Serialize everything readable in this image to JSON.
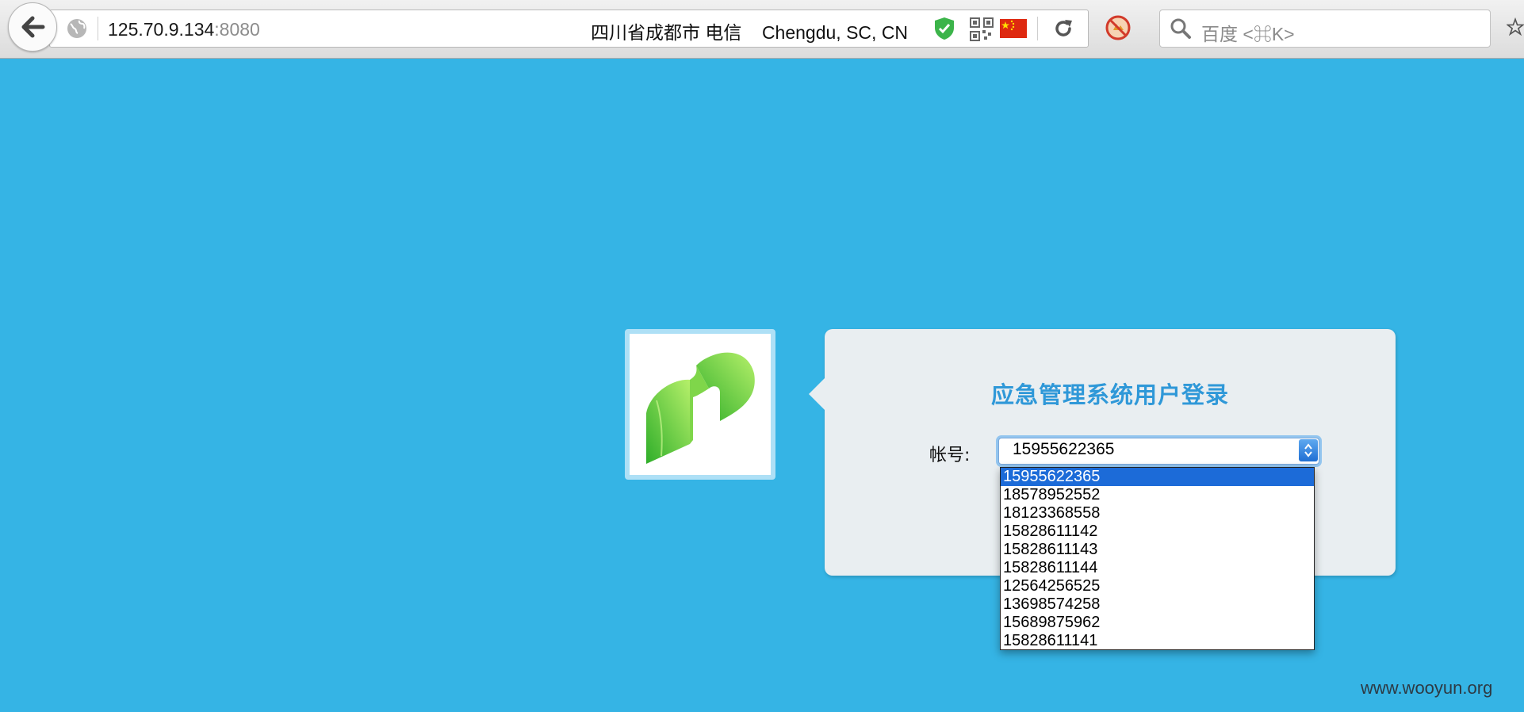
{
  "browser": {
    "url_host": "125.70.9.134",
    "url_port": ":8080",
    "geo_location": "四川省成都市 电信    Chengdu, SC, CN",
    "search_placeholder": "百度 <⌘K>",
    "icons": [
      "back-arrow-icon",
      "globe-icon",
      "shield-icon",
      "qr-code-icon",
      "china-flag-icon",
      "reload-icon",
      "adblock-icon",
      "search-icon",
      "bookmark-star-icon"
    ]
  },
  "login": {
    "title": "应急管理系统用户登录",
    "account_label": "帐号:",
    "selected_account": "15955622365",
    "accounts": [
      "15955622365",
      "18578952552",
      "18123368558",
      "15828611142",
      "15828611143",
      "15828611144",
      "12564256525",
      "13698574258",
      "15689875962",
      "15828611141"
    ]
  },
  "watermark": "www.wooyun.org",
  "colors": {
    "page_background": "#35b4e5",
    "title": "#2f98d8",
    "selected_option": "#1c6bd8",
    "logo_green": "#4cc22f"
  }
}
